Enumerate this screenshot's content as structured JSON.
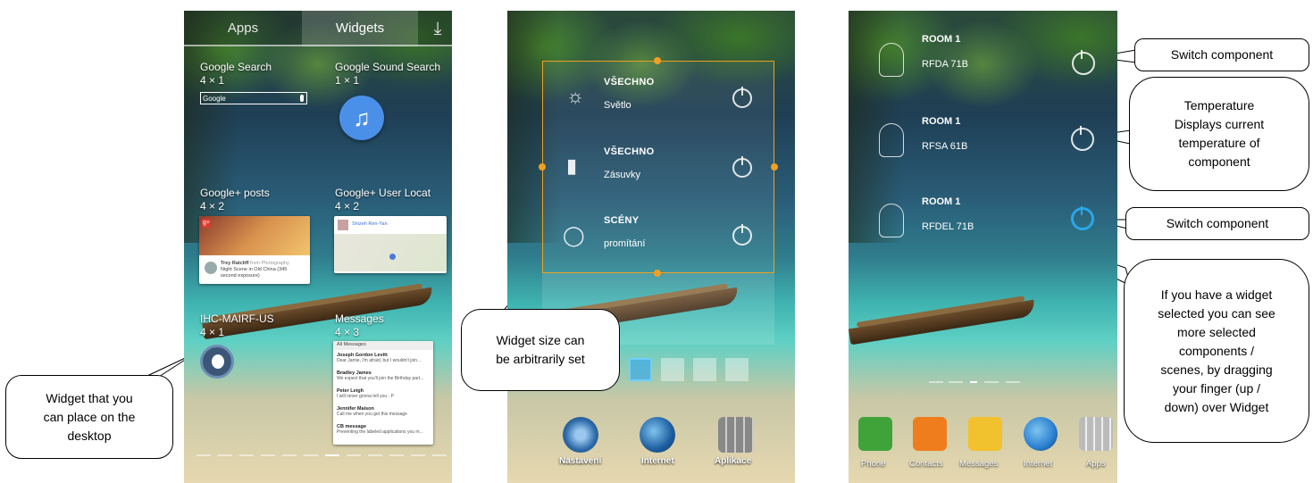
{
  "screen1": {
    "tabs": [
      "Apps",
      "Widgets"
    ],
    "widgets": [
      {
        "name": "Google Search",
        "size": "4 × 1"
      },
      {
        "name": "Google Sound Search",
        "size": "1 × 1"
      },
      {
        "name": "Google+ posts",
        "size": "4 × 2"
      },
      {
        "name": "Google+ User Locat",
        "size": "4 × 2"
      },
      {
        "name": "IHC-MAIRF-US",
        "size": "4 × 1"
      },
      {
        "name": "Messages",
        "size": "4 × 3"
      }
    ],
    "search_placeholder": "Google",
    "gplus_author": "Trey Ratcliff",
    "gplus_from": "from Photography",
    "gplus_text_1": "Night Scene in Old China (345",
    "gplus_text_2": "second exposure)",
    "location_name": "Shizeh Ren-Yan",
    "messages_header": "All Messages",
    "messages": [
      {
        "from": "Joseph Gordon Levitt",
        "text": "Dear Jamie, I'm afraid, but I wouldn't join..."
      },
      {
        "from": "Bradley James",
        "text": "We expect that you'll join the Birthday part..."
      },
      {
        "from": "Peter Leigh",
        "text": "I will never gonna tell you - P"
      },
      {
        "from": "Jennifer Maison",
        "text": "Call me when you get this message"
      },
      {
        "from": "CB message",
        "text": "Preventing the labeled applications you m..."
      }
    ]
  },
  "screen2": {
    "items": [
      {
        "title": "VŠECHNO",
        "sub": "Světlo"
      },
      {
        "title": "VŠECHNO",
        "sub": "Zásuvky"
      },
      {
        "title": "SCÉNY",
        "sub": "promítání"
      }
    ],
    "dock": [
      "Nastavení",
      "Internet",
      "Aplikace"
    ]
  },
  "screen3": {
    "items": [
      {
        "title": "ROOM 1",
        "sub": "RFDA 71B"
      },
      {
        "title": "ROOM 1",
        "sub": "RFSA 61B"
      },
      {
        "title": "ROOM 1",
        "sub": "RFDEL 71B"
      }
    ],
    "dock": [
      "Phone",
      "Contacts",
      "Messages",
      "Internet",
      "Apps"
    ],
    "colors": {
      "phone": "#3fa33a",
      "contacts": "#ef7d1d",
      "messages": "#f2c12e",
      "internet": "#2a7fd0",
      "apps": "#d9d9d9",
      "power_active": "#2aa6e8"
    }
  },
  "callouts": {
    "widget_place": [
      "Widget that you",
      "can place on the",
      "desktop"
    ],
    "widget_size": [
      "Widget size can",
      "be arbitrarily set"
    ],
    "switch1": [
      "Switch component"
    ],
    "temperature": [
      "Temperature",
      "Displays current",
      "temperature of",
      "component"
    ],
    "switch2": [
      "Switch component"
    ],
    "drag_info": [
      "If you have a widget",
      "selected you can see",
      "more selected",
      "components /",
      "scenes, by dragging",
      "your finger (up /",
      "down) over Widget"
    ]
  },
  "frame_color": "#f0a020"
}
